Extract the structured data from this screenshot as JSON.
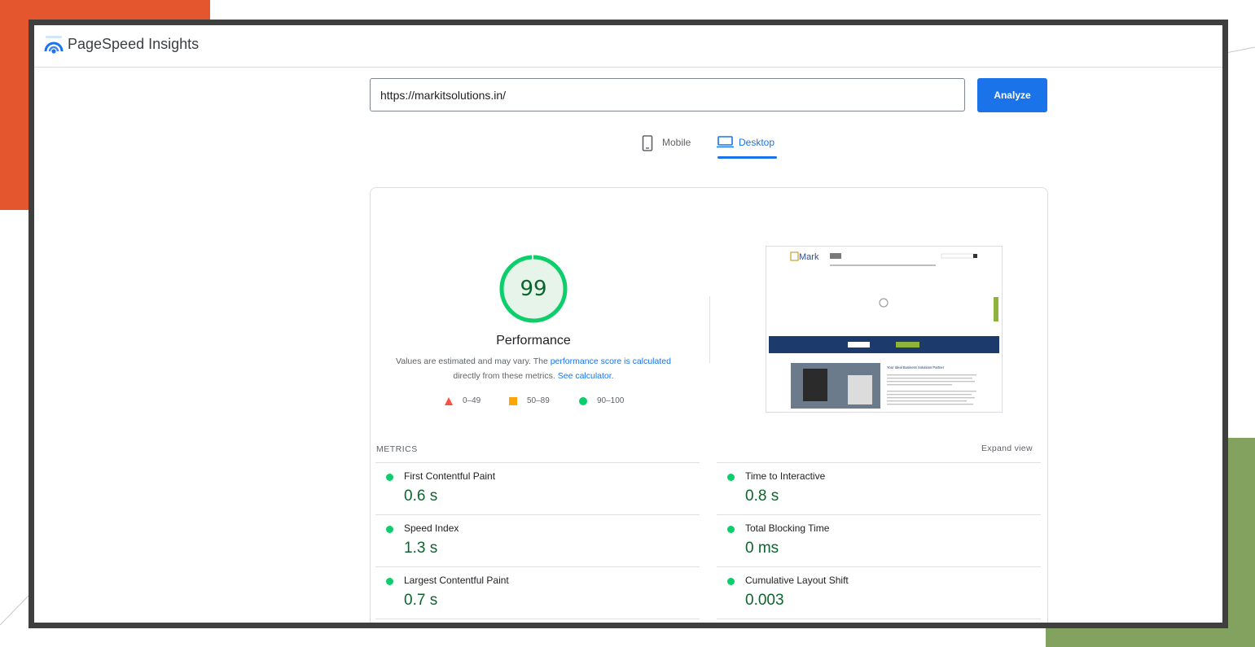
{
  "header": {
    "title": "PageSpeed Insights"
  },
  "search": {
    "url_value": "https://markitsolutions.in/",
    "analyze_label": "Analyze"
  },
  "tabs": [
    {
      "label": "Mobile",
      "active": false
    },
    {
      "label": "Desktop",
      "active": true
    }
  ],
  "performance": {
    "score": "99",
    "score_fraction": 0.99,
    "title": "Performance",
    "desc_prefix": "Values are estimated and may vary. The ",
    "desc_link": "performance score is calculated",
    "desc_mid": "directly from these metrics. ",
    "desc_link2": "See calculator",
    "desc_suffix": "."
  },
  "legend": [
    {
      "range": "0–49",
      "color": "#ff4e42",
      "shape": "triangle"
    },
    {
      "range": "50–89",
      "color": "#ffa400",
      "shape": "square"
    },
    {
      "range": "90–100",
      "color": "#0cce6b",
      "shape": "circle"
    }
  ],
  "screenshot": {
    "logo_text": "Mark",
    "hero_button": "",
    "heading": "Your Ideal Business Solutions Partner"
  },
  "metrics": {
    "label": "METRICS",
    "expand_label": "Expand view",
    "items": [
      {
        "name": "First Contentful Paint",
        "value": "0.6 s"
      },
      {
        "name": "Time to Interactive",
        "value": "0.8 s"
      },
      {
        "name": "Speed Index",
        "value": "1.3 s"
      },
      {
        "name": "Total Blocking Time",
        "value": "0 ms"
      },
      {
        "name": "Largest Contentful Paint",
        "value": "0.7 s"
      },
      {
        "name": "Cumulative Layout Shift",
        "value": "0.003"
      }
    ]
  },
  "colors": {
    "accent": "#1a73e8",
    "pass": "#0cce6b",
    "pass_text": "#0d652d",
    "deco_orange": "#e4572e",
    "deco_green": "#84a25f",
    "frame": "#3f3f3f"
  }
}
